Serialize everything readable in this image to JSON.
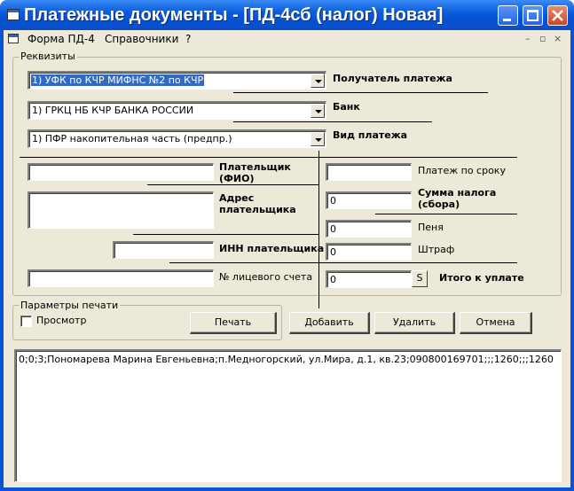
{
  "window": {
    "title": "Платежные документы - [ПД-4сб  (налог) Новая]"
  },
  "menu": {
    "items": [
      "Форма ПД-4",
      "Справочники",
      "?"
    ],
    "mdi_minimize": "–",
    "mdi_restore": "▫",
    "mdi_close": "×"
  },
  "requisites": {
    "legend": "Реквизиты",
    "recipient_value": "1) УФК по КЧР МИФНС №2 по КЧР",
    "recipient_label": "Получатель платежа",
    "bank_value": "1) ГРКЦ НБ КЧР БАНКА РОССИИ",
    "bank_label": "Банк",
    "payment_type_value": "1) ПФР накопительная часть (предпр.)",
    "payment_type_label": "Вид платежа",
    "payer_value": "",
    "payer_label": "Плательщик (ФИО)",
    "address_value": "",
    "address_label": "Адрес плательщика",
    "inn_value": "",
    "inn_label": "ИНН плательщика",
    "account_value": "",
    "account_label": "№ лицевого счета",
    "due_value": "",
    "due_label": "Платеж по сроку",
    "tax_value": "0",
    "tax_label": "Сумма налога (сбора)",
    "penalty_value": "0",
    "penalty_label": "Пеня",
    "fine_value": "0",
    "fine_label": "Штраф",
    "total_value": "0",
    "total_button": "S",
    "total_label": "Итого к уплате"
  },
  "print_params": {
    "legend": "Параметры печати",
    "preview_label": "Просмотр",
    "preview_checked": false,
    "print_button": "Печать"
  },
  "actions": {
    "add": "Добавить",
    "delete": "Удалить",
    "cancel": "Отмена"
  },
  "output": {
    "line": "0;0;3;Пономарева Марина Евгеньевна;п.Медногорский, ул.Мира, д.1, кв.23;090800169701;;;1260;;;1260"
  }
}
